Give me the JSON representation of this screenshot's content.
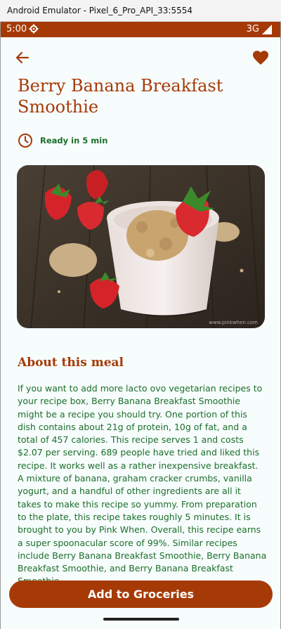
{
  "window": {
    "title": "Android Emulator - Pixel_6_Pro_API_33:5554"
  },
  "statusbar": {
    "time": "5:00",
    "network": "3G"
  },
  "recipe": {
    "title": "Berry Banana Breakfast Smoothie",
    "ready_text": "Ready in 5 min",
    "image_watermark": "www.pinkwhen.com",
    "about_heading": "About this meal",
    "description": "If you want to add more lacto ovo vegetarian recipes to your recipe box, Berry Banana Breakfast Smoothie might be a recipe you should try. One portion of this dish contains about 21g of protein, 10g of fat, and a total of 457 calories. This recipe serves 1 and costs $2.07 per serving. 689 people have tried and liked this recipe. It works well as a rather inexpensive breakfast. A mixture of banana, graham cracker crumbs, vanilla yogurt, and a handful of other ingredients are all it takes to make this recipe so yummy. From preparation to the plate, this recipe takes roughly 5 minutes. It is brought to you by Pink When. Overall, this recipe earns a super spoonacular score of 99%. Similar recipes include Berry Banana Breakfast Smoothie, Berry Banana Breakfast Smoothie, and Berry Banana Breakfast Smoothie.",
    "favorite": true
  },
  "actions": {
    "add_label": "Add to Groceries"
  },
  "icons": {
    "back": "arrow-left-icon",
    "favorite": "heart-icon",
    "time": "clock-icon"
  },
  "colors": {
    "primary": "#a63a07",
    "text_green": "#1b6f2a",
    "background": "#f7fcfd"
  }
}
